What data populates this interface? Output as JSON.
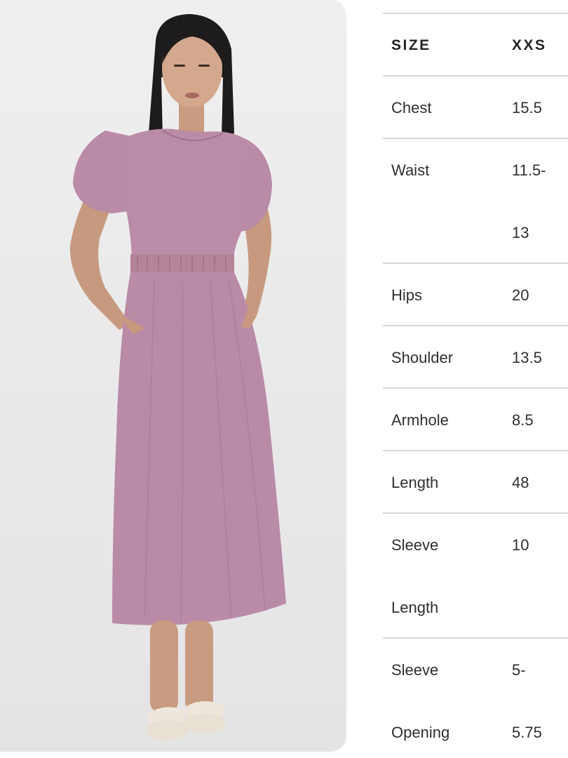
{
  "photo": {
    "description_icon": "product-model-photo",
    "colors": {
      "background": "#ebebeb",
      "dress": "#b98aa6",
      "skin": "#c89a7e",
      "hair": "#1c1a1a",
      "sandal": "#ece3d7"
    }
  },
  "size_chart": {
    "header": {
      "label": "SIZE",
      "value": "XXS"
    },
    "rows": [
      {
        "label": "Chest",
        "value": "15.5"
      },
      {
        "label": "Waist",
        "value": "11.5-",
        "value_cont": "13"
      },
      {
        "label": "Hips",
        "value": "20"
      },
      {
        "label": "Shoulder",
        "value": "13.5"
      },
      {
        "label": "Armhole",
        "value": "8.5"
      },
      {
        "label": "Length",
        "value": "48"
      },
      {
        "label": "Sleeve",
        "label_cont": "Length",
        "value": "10"
      },
      {
        "label": "Sleeve",
        "label_cont": "Opening",
        "value": "5-",
        "value_cont": "5.75"
      }
    ],
    "rule_color": "#d8d8d8"
  }
}
